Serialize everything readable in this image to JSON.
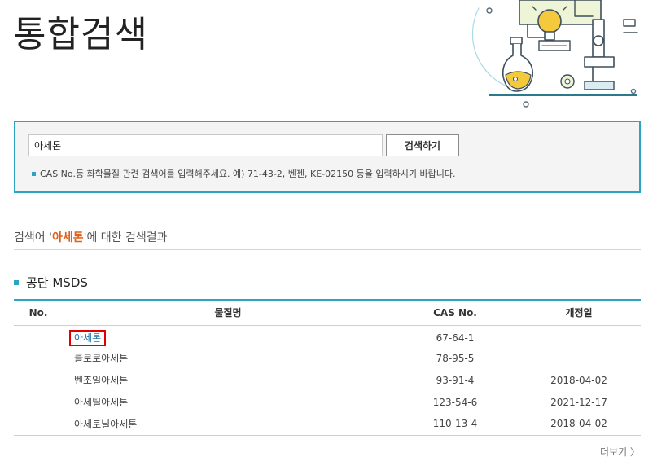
{
  "page": {
    "title": "통합검색"
  },
  "search": {
    "value": "아세톤",
    "button_label": "검색하기",
    "hint": "CAS No.등 화학물질 관련 검색어를 입력해주세요. 예) 71-43-2, 벤젠, KE-02150 등을 입력하시기 바랍니다."
  },
  "summary": {
    "prefix": "검색어 '",
    "keyword": "아세톤",
    "suffix": "'에 대한 검색결과"
  },
  "section": {
    "title": "공단 MSDS"
  },
  "table": {
    "headers": {
      "no": "No.",
      "name": "물질명",
      "cas": "CAS No.",
      "date": "개정일"
    },
    "rows": [
      {
        "no": "",
        "name": "아세톤",
        "cas": "67-64-1",
        "date": ""
      },
      {
        "no": "",
        "name": "클로로아세톤",
        "cas": "78-95-5",
        "date": ""
      },
      {
        "no": "",
        "name": "벤조일아세톤",
        "cas": "93-91-4",
        "date": "2018-04-02"
      },
      {
        "no": "",
        "name": "아세틸아세톤",
        "cas": "123-54-6",
        "date": "2021-12-17"
      },
      {
        "no": "",
        "name": "아세토닐아세톤",
        "cas": "110-13-4",
        "date": "2018-04-02"
      }
    ]
  },
  "more": {
    "label": "더보기 〉"
  },
  "colors": {
    "accent": "#2aa4c0",
    "keyword": "#e0611a",
    "highlight": "#e00000"
  },
  "icons": {
    "illustration": "lab-illustration-icon",
    "bulb": "lightbulb-icon",
    "microscope": "microscope-icon",
    "flask": "flask-icon"
  }
}
